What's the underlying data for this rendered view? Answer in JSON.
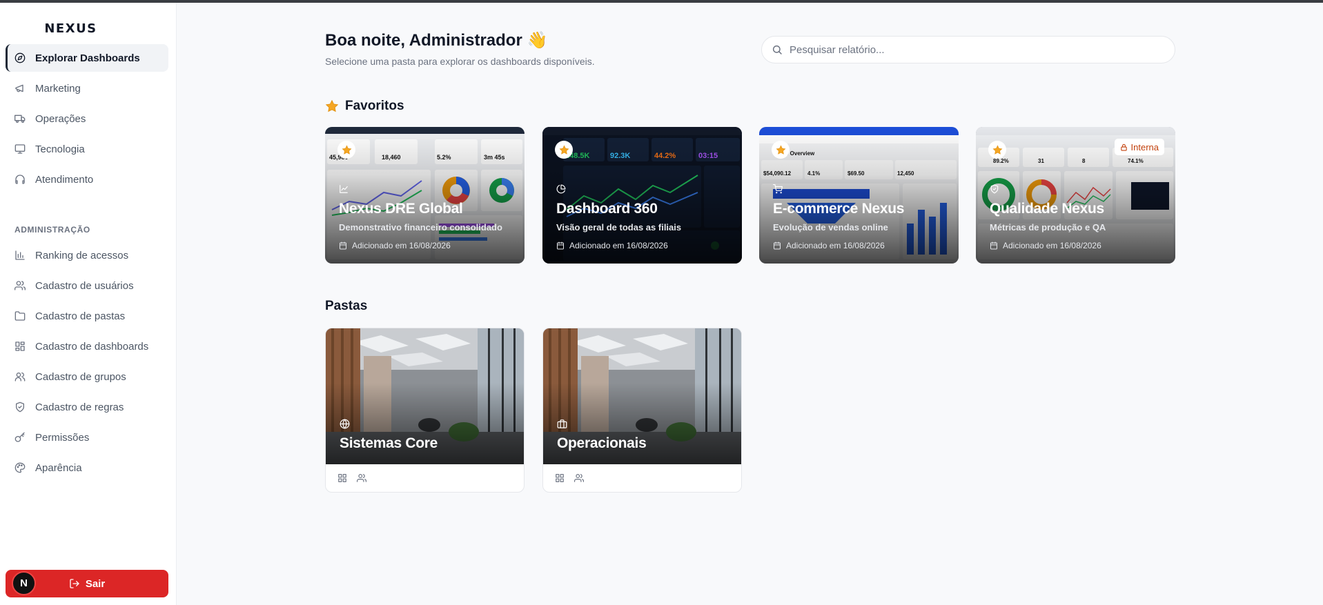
{
  "app": {
    "logo": "NEXUS"
  },
  "sidebar": {
    "items": [
      {
        "label": "Explorar Dashboards",
        "icon": "compass-icon",
        "active": true
      },
      {
        "label": "Marketing",
        "icon": "megaphone-icon"
      },
      {
        "label": "Operações",
        "icon": "truck-icon"
      },
      {
        "label": "Tecnologia",
        "icon": "monitor-icon"
      },
      {
        "label": "Atendimento",
        "icon": "headphones-icon"
      }
    ],
    "admin_label": "ADMINISTRAÇÃO",
    "admin_items": [
      {
        "label": "Ranking de acessos",
        "icon": "bar-chart-icon"
      },
      {
        "label": "Cadastro de usuários",
        "icon": "users-icon"
      },
      {
        "label": "Cadastro de pastas",
        "icon": "folder-icon"
      },
      {
        "label": "Cadastro de dashboards",
        "icon": "grid-icon"
      },
      {
        "label": "Cadastro de grupos",
        "icon": "group-icon"
      },
      {
        "label": "Cadastro de regras",
        "icon": "shield-icon"
      },
      {
        "label": "Permissões",
        "icon": "key-icon"
      },
      {
        "label": "Aparência",
        "icon": "palette-icon"
      }
    ],
    "avatar_initial": "N",
    "logout_label": "Sair"
  },
  "header": {
    "greeting": "Boa noite, Administrador 👋",
    "subtitle": "Selecione uma pasta para explorar os dashboards disponíveis.",
    "search_placeholder": "Pesquisar relatório..."
  },
  "favorites": {
    "title": "Favoritos",
    "items": [
      {
        "title": "Nexus DRE Global",
        "description": "Demonstrativo financeiro consolidado",
        "added": "Adicionado em 16/08/2026",
        "icon": "line-chart-icon"
      },
      {
        "title": "Dashboard 360",
        "description": "Visão geral de todas as filiais",
        "added": "Adicionado em 16/08/2026",
        "icon": "pie-chart-icon"
      },
      {
        "title": "E-commerce Nexus",
        "description": "Evolução de vendas online",
        "added": "Adicionado em 16/08/2026",
        "icon": "cart-icon"
      },
      {
        "title": "Qualidade Nexus",
        "description": "Métricas de produção e QA",
        "added": "Adicionado em 16/08/2026",
        "icon": "shield-check-icon",
        "badge": "Interna"
      }
    ]
  },
  "folders": {
    "title": "Pastas",
    "items": [
      {
        "title": "Sistemas Core",
        "icon": "globe-icon"
      },
      {
        "title": "Operacionais",
        "icon": "briefcase-icon"
      }
    ]
  },
  "colors": {
    "accent": "#1f2937",
    "logout": "#dc2626",
    "star": "#f5a623",
    "badge_text": "#c2410c"
  }
}
